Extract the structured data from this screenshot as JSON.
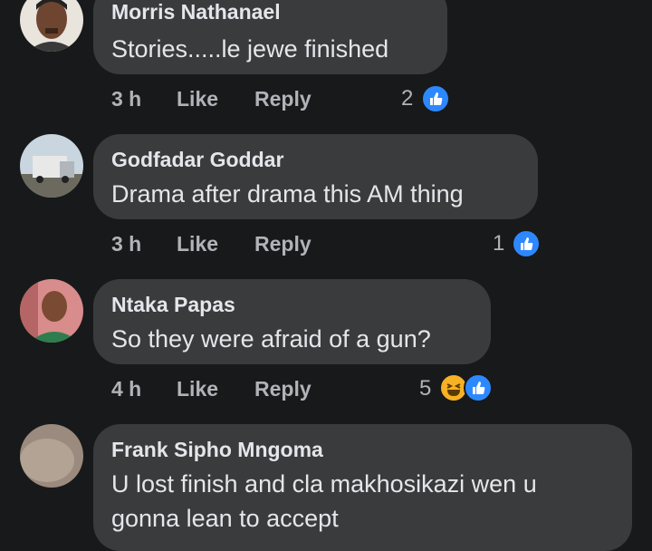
{
  "comments": [
    {
      "author": "Morris Nathanael",
      "text_lines": [
        "Stories.....le jewe finished"
      ],
      "time": "3 h",
      "like_label": "Like",
      "reply_label": "Reply",
      "reaction_count": "2",
      "reactions": [
        "like-icon"
      ]
    },
    {
      "author": "Godfadar Goddar",
      "text_lines": [
        "Drama after drama this AM thing"
      ],
      "time": "3 h",
      "like_label": "Like",
      "reply_label": "Reply",
      "reaction_count": "1",
      "reactions": [
        "like-icon"
      ]
    },
    {
      "author": "Ntaka Papas",
      "text_lines": [
        "So they were afraid of a gun?"
      ],
      "time": "4 h",
      "like_label": "Like",
      "reply_label": "Reply",
      "reaction_count": "5",
      "reactions": [
        "haha-icon",
        "like-icon"
      ]
    },
    {
      "author": "Frank Sipho Mngoma",
      "text_lines": [
        "U lost finish and cla makhosikazi wen u",
        "gonna lean to accept"
      ]
    }
  ],
  "colors": {
    "background": "#18191a",
    "bubble": "#3a3b3c",
    "text": "#e4e6eb",
    "secondary_text": "#b0b3b8",
    "like_blue": "#2d88ff",
    "haha_yellow": "#f7b125"
  }
}
